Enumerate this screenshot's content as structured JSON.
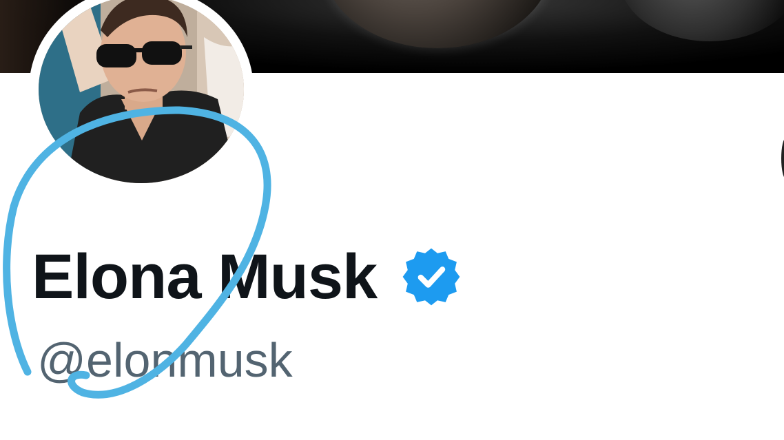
{
  "profile": {
    "display_name": "Elona Musk",
    "handle": "@elonmusk",
    "verified": true
  },
  "colors": {
    "verified_badge": "#1d9bf0",
    "annotation_stroke": "#4fb3e3",
    "name_text": "#0f1419",
    "handle_text": "#536471"
  },
  "icons": {
    "verified": "verified-badge-icon"
  }
}
